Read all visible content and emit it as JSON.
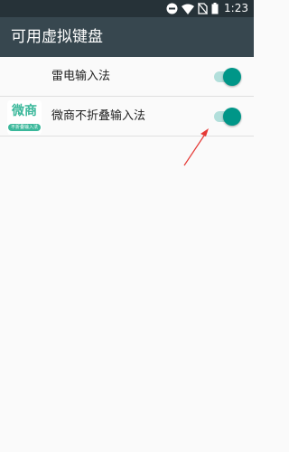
{
  "status_bar": {
    "time": "1:23",
    "icons": [
      "minus-circle-icon",
      "wifi-icon",
      "no-sim-icon",
      "battery-icon"
    ]
  },
  "action_bar": {
    "title": "可用虚拟键盘"
  },
  "keyboards": [
    {
      "label": "雷电输入法",
      "enabled": true,
      "icon": "none"
    },
    {
      "label": "微商不折叠输入法",
      "enabled": true,
      "icon": "weishang-app-icon",
      "icon_text": "微商",
      "icon_tag": "不折叠输入法"
    }
  ],
  "colors": {
    "status_bar": "#263238",
    "action_bar": "#37474f",
    "switch_on_thumb": "#009688",
    "switch_on_track": "#b2dfdb",
    "annotation_arrow": "#e53935"
  }
}
